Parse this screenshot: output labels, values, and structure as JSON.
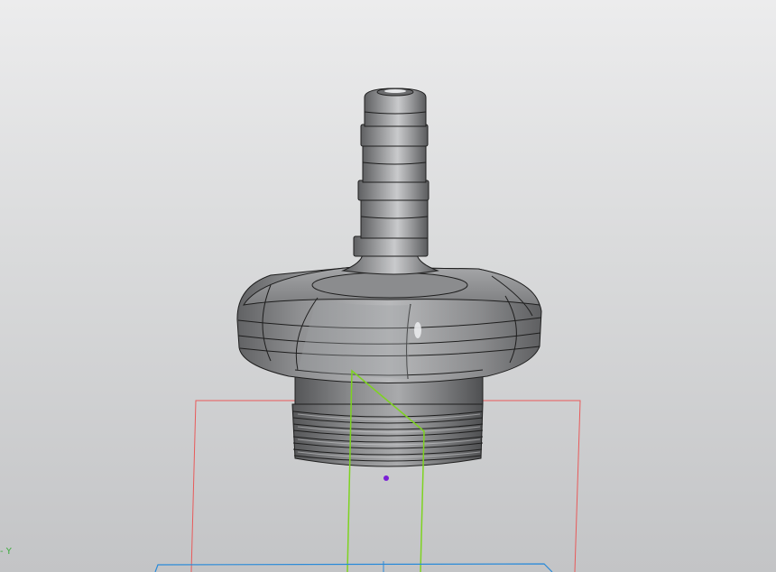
{
  "viewport": {
    "axis_label": "- Y",
    "colors": {
      "background_top": "#ececed",
      "background_bottom": "#c3c4c6",
      "part_body": "#8d8e90",
      "part_edge": "#1e1e1e",
      "plane_red": "#e85a5a",
      "plane_green": "#7ed321",
      "plane_blue": "#2a8ad8",
      "origin_point": "#7a1fd6"
    },
    "model": {
      "name": "hose-barb-fitting",
      "features": [
        "hose-barb",
        "hex-nut-body",
        "threaded-shank"
      ]
    }
  }
}
